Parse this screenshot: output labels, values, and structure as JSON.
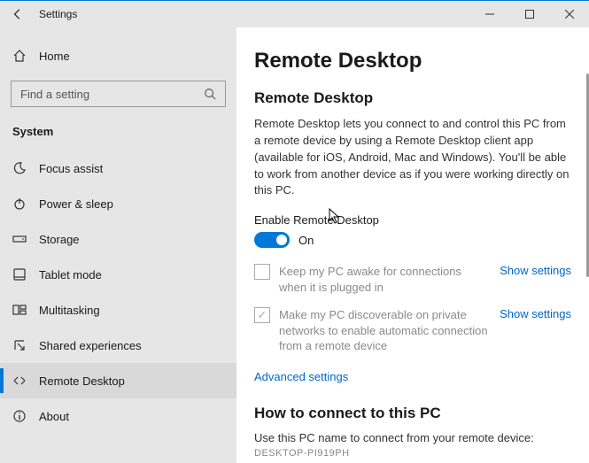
{
  "window": {
    "title": "Settings"
  },
  "sidebar": {
    "home_label": "Home",
    "search_placeholder": "Find a setting",
    "group": "System",
    "items": [
      {
        "label": "Focus assist",
        "icon": "moon"
      },
      {
        "label": "Power & sleep",
        "icon": "power"
      },
      {
        "label": "Storage",
        "icon": "drive"
      },
      {
        "label": "Tablet mode",
        "icon": "tablet"
      },
      {
        "label": "Multitasking",
        "icon": "multitask"
      },
      {
        "label": "Shared experiences",
        "icon": "share"
      },
      {
        "label": "Remote Desktop",
        "icon": "remote",
        "selected": true
      },
      {
        "label": "About",
        "icon": "info"
      }
    ]
  },
  "main": {
    "page_title": "Remote Desktop",
    "section_title": "Remote Desktop",
    "description": "Remote Desktop lets you connect to and control this PC from a remote device by using a Remote Desktop client app (available for iOS, Android, Mac and Windows). You'll be able to work from another device as if you were working directly on this PC.",
    "toggle_label": "Enable Remote Desktop",
    "toggle_state": "On",
    "options": [
      {
        "checked": false,
        "text": "Keep my PC awake for connections when it is plugged in",
        "link": "Show settings"
      },
      {
        "checked": true,
        "text": "Make my PC discoverable on private networks to enable automatic connection from a remote device",
        "link": "Show settings"
      }
    ],
    "advanced_link": "Advanced settings",
    "connect_title": "How to connect to this PC",
    "connect_text": "Use this PC name to connect from your remote device:",
    "pc_name": "DESKTOP-PI919PH"
  }
}
